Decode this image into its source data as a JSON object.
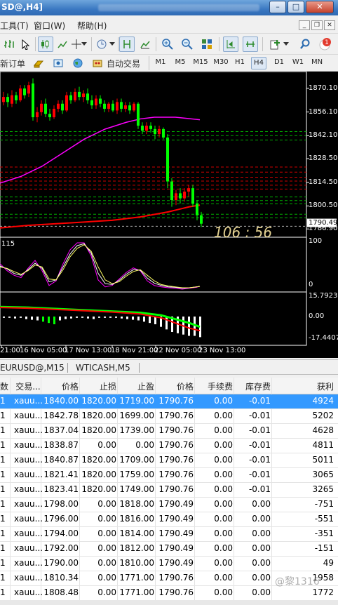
{
  "window": {
    "title": "SD@,H4]"
  },
  "menu": {
    "items": [
      {
        "label": "工具(T)"
      },
      {
        "label": "窗口(W)"
      },
      {
        "label": "帮助(H)"
      }
    ]
  },
  "toolbar2": {
    "new_order": "新订单",
    "auto_trade": "自动交易",
    "timeframes": [
      "M1",
      "M5",
      "M15",
      "M30",
      "H1",
      "H4",
      "D1",
      "W1",
      "MN"
    ],
    "active_timeframe": "H4"
  },
  "chart": {
    "price_ticks": [
      "1870.10",
      "1856.10",
      "1842.10",
      "1828.50",
      "1814.50",
      "1800.50",
      "1786.90"
    ],
    "current_price": "1790.49",
    "overlay_text": "106 : 56",
    "stoch_label": "115",
    "stoch_ticks": [
      "100",
      "0"
    ],
    "macd_ticks": [
      "15.7923",
      "0.00",
      "-17.4407"
    ],
    "time_ticks": [
      "21:00",
      "16 Nov 05:00",
      "17 Nov 13:00",
      "18 Nov 21:00",
      "22 Nov 05:00",
      "23 Nov 13:00"
    ],
    "colors": {
      "bull": "#00ff00",
      "bear": "#ff0000",
      "ma_fast": "#ff00ff",
      "ma_slow": "#ff0000",
      "stoch_main": "#ff00ff",
      "stoch_signal": "#ffff66",
      "macd_signal_up": "#00ff00",
      "macd_signal_down": "#ff0000"
    }
  },
  "chart_tabs": [
    "EURUSD@,M15",
    "WTICASH,M5"
  ],
  "table": {
    "headers": [
      "数",
      "交易...",
      "价格",
      "止损",
      "止盈",
      "价格",
      "手续费",
      "库存费",
      "获利"
    ],
    "rows": [
      [
        "1",
        "xauu...",
        "1840.00",
        "1820.00",
        "1719.00",
        "1790.76",
        "0.00",
        "-0.01",
        "4924"
      ],
      [
        "1",
        "xauu...",
        "1842.78",
        "1820.00",
        "1699.00",
        "1790.76",
        "0.00",
        "-0.01",
        "5202"
      ],
      [
        "1",
        "xauu...",
        "1837.04",
        "1820.00",
        "1739.00",
        "1790.76",
        "0.00",
        "-0.01",
        "4628"
      ],
      [
        "1",
        "xauu...",
        "1838.87",
        "0.00",
        "0.00",
        "1790.76",
        "0.00",
        "-0.01",
        "4811"
      ],
      [
        "1",
        "xauu...",
        "1840.87",
        "1820.00",
        "1709.00",
        "1790.76",
        "0.00",
        "-0.01",
        "5011"
      ],
      [
        "1",
        "xauu...",
        "1821.41",
        "1820.00",
        "1759.00",
        "1790.76",
        "0.00",
        "-0.01",
        "3065"
      ],
      [
        "1",
        "xauu...",
        "1823.41",
        "1820.00",
        "1749.00",
        "1790.76",
        "0.00",
        "-0.01",
        "3265"
      ],
      [
        "1",
        "xauu...",
        "1798.00",
        "0.00",
        "1818.00",
        "1790.49",
        "0.00",
        "0.00",
        "-751"
      ],
      [
        "1",
        "xauu...",
        "1796.00",
        "0.00",
        "1816.00",
        "1790.49",
        "0.00",
        "0.00",
        "-551"
      ],
      [
        "1",
        "xauu...",
        "1794.00",
        "0.00",
        "1814.00",
        "1790.49",
        "0.00",
        "0.00",
        "-351"
      ],
      [
        "1",
        "xauu...",
        "1792.00",
        "0.00",
        "1812.00",
        "1790.49",
        "0.00",
        "0.00",
        "-151"
      ],
      [
        "1",
        "xauu...",
        "1790.00",
        "0.00",
        "1810.00",
        "1790.49",
        "0.00",
        "0.00",
        "49"
      ],
      [
        "1",
        "xauu...",
        "1810.34",
        "0.00",
        "1771.00",
        "1790.76",
        "0.00",
        "0.00",
        "1958"
      ],
      [
        "1",
        "xauu...",
        "1808.48",
        "0.00",
        "1771.00",
        "1790.76",
        "0.00",
        "0.00",
        "1772"
      ]
    ]
  },
  "watermark": "@黎1316"
}
